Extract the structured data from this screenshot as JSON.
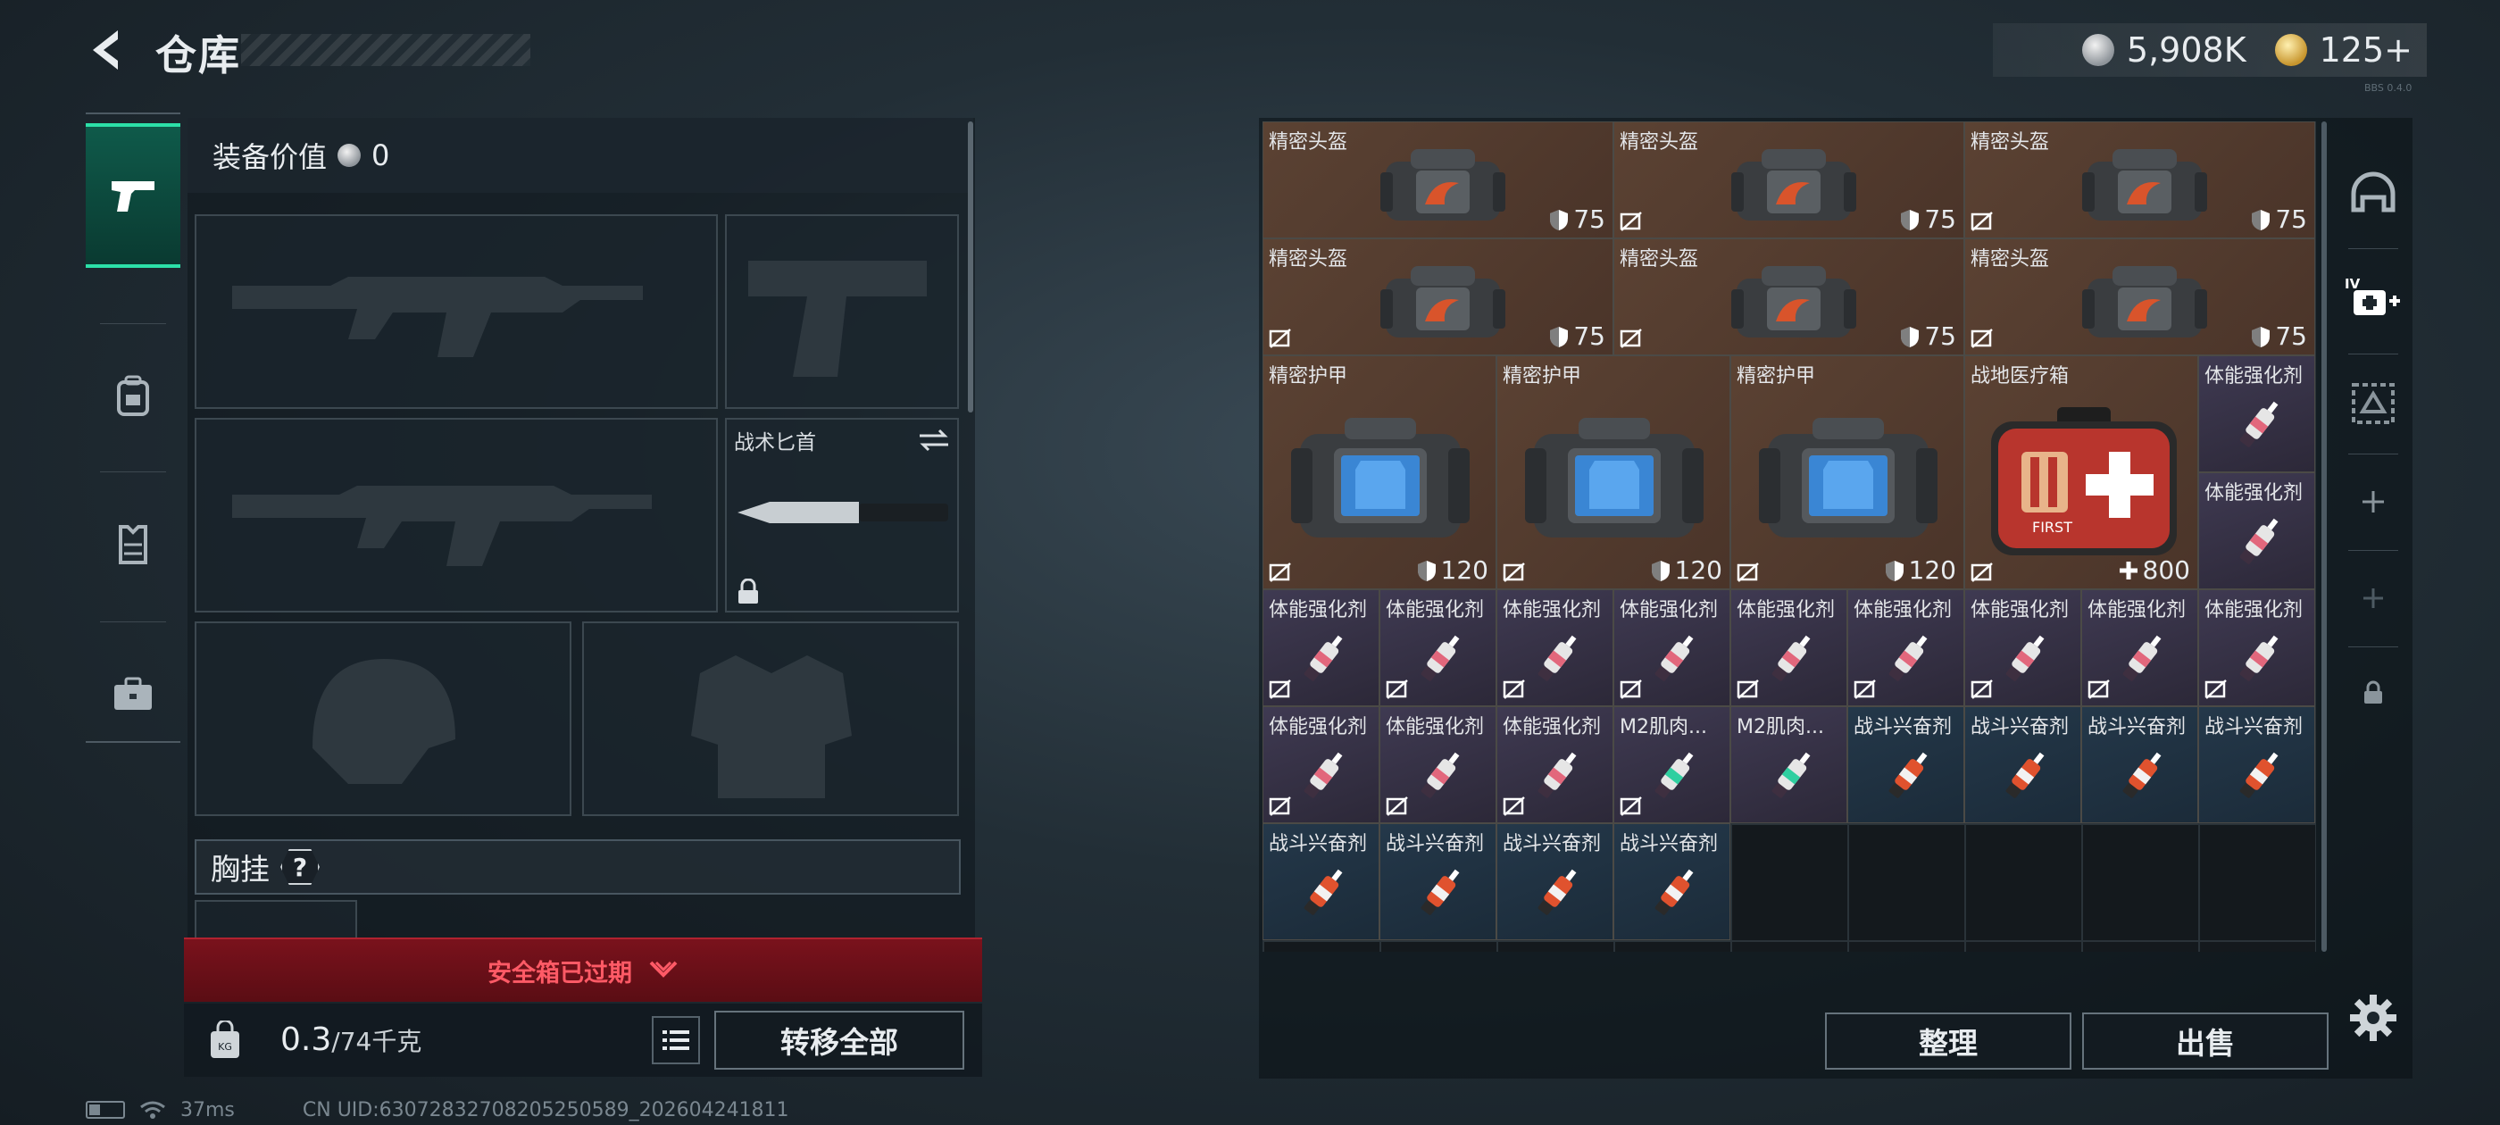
{
  "header": {
    "title": "仓库",
    "silver": "5,908K",
    "gold": "125+",
    "server_tag": "BBS 0.4.0"
  },
  "equipment": {
    "value_label": "装备价值",
    "value": "0",
    "knife_slot_label": "战术匕首",
    "chest_rig_label": "胸挂",
    "chest_rig_help": "?"
  },
  "safebox": {
    "banner": "安全箱已过期"
  },
  "inventory_bar": {
    "weight_current": "0.3",
    "weight_max": "/74千克",
    "transfer_all": "转移全部"
  },
  "status": {
    "ping": "37ms",
    "uid": "CN UID:6307283270820525058​9_202604241811"
  },
  "stash": {
    "items": [
      {
        "label": "精密头盔",
        "value": "75",
        "kind": "helmet"
      },
      {
        "label": "精密头盔",
        "value": "75",
        "kind": "helmet"
      },
      {
        "label": "精密头盔",
        "value": "75",
        "kind": "helmet"
      },
      {
        "label": "精密头盔",
        "value": "75",
        "kind": "helmet"
      },
      {
        "label": "精密头盔",
        "value": "75",
        "kind": "helmet"
      },
      {
        "label": "精密头盔",
        "value": "75",
        "kind": "helmet"
      },
      {
        "label": "精密护甲",
        "value": "120",
        "kind": "armor"
      },
      {
        "label": "精密护甲",
        "value": "120",
        "kind": "armor"
      },
      {
        "label": "精密护甲",
        "value": "120",
        "kind": "armor"
      },
      {
        "label": "战地医疗箱",
        "value": "800",
        "kind": "medkit"
      },
      {
        "label": "体能强化剂",
        "kind": "stim"
      },
      {
        "label": "体能强化剂",
        "kind": "stim"
      },
      {
        "label": "体能强化剂",
        "kind": "stim"
      },
      {
        "label": "体能强化剂",
        "kind": "stim"
      },
      {
        "label": "体能强化剂",
        "kind": "stim"
      },
      {
        "label": "体能强化剂",
        "kind": "stim"
      },
      {
        "label": "体能强化剂",
        "kind": "stim"
      },
      {
        "label": "体能强化剂",
        "kind": "stim"
      },
      {
        "label": "体能强化剂",
        "kind": "stim"
      },
      {
        "label": "体能强化剂",
        "kind": "stim"
      },
      {
        "label": "体能强化剂",
        "kind": "stim"
      },
      {
        "label": "体能强化剂",
        "kind": "stim"
      },
      {
        "label": "体能强化剂",
        "kind": "stim"
      },
      {
        "label": "体能强化剂",
        "kind": "stim"
      },
      {
        "label": "M2肌肉...",
        "kind": "m2"
      },
      {
        "label": "战斗兴奋剂",
        "kind": "combat"
      },
      {
        "label": "战斗兴奋剂",
        "kind": "combat"
      },
      {
        "label": "战斗兴奋剂",
        "kind": "combat"
      },
      {
        "label": "战斗兴奋剂",
        "kind": "combat"
      },
      {
        "label": "战斗兴奋剂",
        "kind": "combat"
      },
      {
        "label": "战斗兴奋剂",
        "kind": "combat"
      },
      {
        "label": "战斗兴奋剂",
        "kind": "combat"
      },
      {
        "label": "战斗兴奋剂",
        "kind": "combat"
      }
    ]
  },
  "actions": {
    "sort": "整理",
    "sell": "出售"
  },
  "colors": {
    "accent": "#2ce0a8",
    "danger": "#b0222f",
    "helmet_bg": "#5b4233",
    "stim_bg": "#3f3a52",
    "combat_bg": "#24384a"
  },
  "icons": [
    "back-arrow-icon",
    "pistol-icon",
    "backpack-icon",
    "vest-icon",
    "toolbox-icon",
    "weight-bag-icon",
    "list-icon",
    "helmet-category-icon",
    "medkit-category-icon",
    "gear-icon"
  ]
}
